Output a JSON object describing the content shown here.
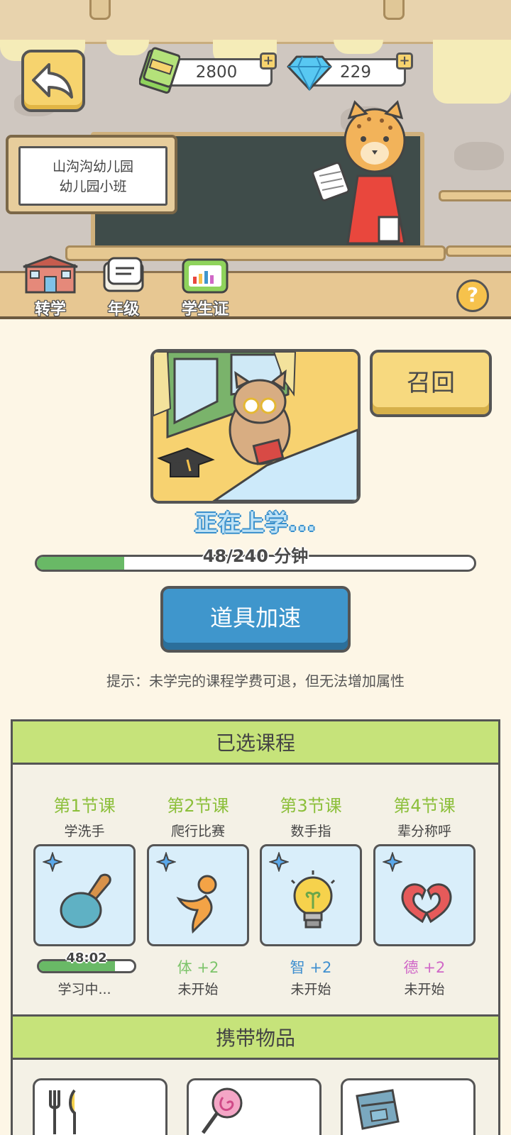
{
  "header": {
    "currency": {
      "money": "2800",
      "gems": "229"
    },
    "school_sign": {
      "line1": "山沟沟幼儿园",
      "line2": "幼儿园小班"
    },
    "toolbar": [
      {
        "label": "转学",
        "icon": "school-building-icon"
      },
      {
        "label": "年级",
        "icon": "book-icon"
      },
      {
        "label": "学生证",
        "icon": "student-card-icon"
      }
    ],
    "help_label": "?"
  },
  "study": {
    "recall_label": "召回",
    "status_text": "正在上学...",
    "progress_text": "48/240 分钟",
    "progress_fraction": 0.2,
    "speed_label": "道具加速",
    "hint": "提示：未学完的课程学费可退，但无法增加属性"
  },
  "courses": {
    "title": "已选课程",
    "items": [
      {
        "index_label": "第1节课",
        "name": "学洗手",
        "icon": "shovel-icon",
        "timer": "48:02",
        "progress_fraction": 0.8,
        "status": "学习中..."
      },
      {
        "index_label": "第2节课",
        "name": "爬行比赛",
        "icon": "running-person-icon",
        "attr": "体 +2",
        "attr_color": "#7cc46a",
        "status": "未开始"
      },
      {
        "index_label": "第3节课",
        "name": "数手指",
        "icon": "lightbulb-icon",
        "attr": "智 +2",
        "attr_color": "#3f8fcf",
        "status": "未开始"
      },
      {
        "index_label": "第4节课",
        "name": "辈分称呼",
        "icon": "heart-hands-icon",
        "attr": "德 +2",
        "attr_color": "#d067c7",
        "status": "未开始"
      }
    ]
  },
  "carry": {
    "title": "携带物品",
    "items": [
      {
        "icon": "fork-knife-icon"
      },
      {
        "icon": "lollipop-icon"
      },
      {
        "icon": "backpack-icon"
      }
    ]
  },
  "colors": {
    "accent_green": "#c6e37a",
    "button_blue": "#3f96cc",
    "button_yellow": "#f7d97f"
  }
}
